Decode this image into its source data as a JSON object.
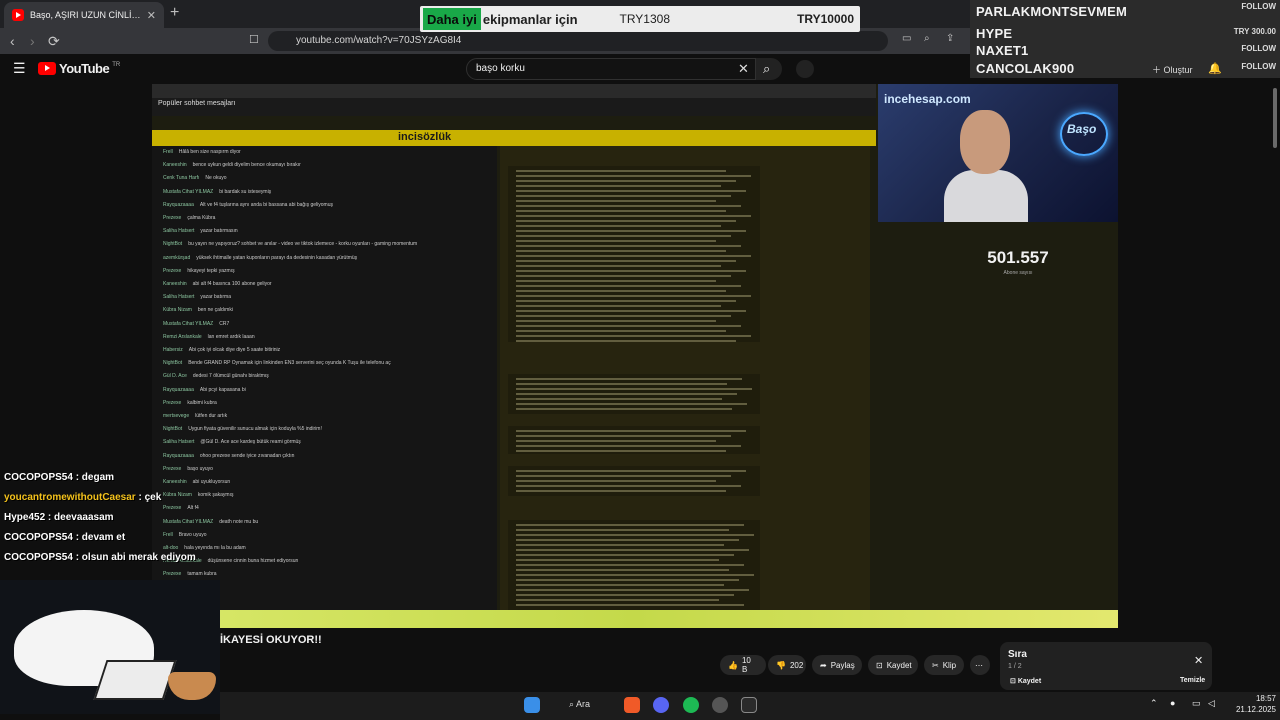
{
  "browser": {
    "tab_title": "Başo, AŞIRI UZUN CİNLİ KORKU...",
    "url": "youtube.com/watch?v=70JSYzAG8I4"
  },
  "ad": {
    "highlight": "Daha iyi",
    "rest": "ekipmanlar için",
    "price1": "TRY1308",
    "price2": "TRY10000"
  },
  "youtube": {
    "logo": "YouTube",
    "region": "TR",
    "search_value": "başo korku",
    "create_label": "Oluştur"
  },
  "donors": [
    {
      "name": "PARLAKMONTSEVMEM",
      "tag": "FOLLOW"
    },
    {
      "name": "HYPE",
      "tag": "TRY 300.00"
    },
    {
      "name": "NAXET1",
      "tag": "FOLLOW"
    },
    {
      "name": "CANCOLAK900",
      "tag": "FOLLOW"
    }
  ],
  "stream": {
    "site_name": "incisözlük",
    "popular_label": "Popüler sohbet mesajları",
    "cam_brand": "incehesap.com",
    "neon": "Başo",
    "counter": "501.557",
    "counter_sub": "Abone sayısı",
    "chat": [
      {
        "n": "Frell",
        "m": "Hâlâ ben size naspırm diyor"
      },
      {
        "n": "Kaneeshin",
        "m": "bence uykun geldi diyelim bence okumayı bırakır"
      },
      {
        "n": "Cenk Tuna Harfı",
        "m": "Ne okuyo"
      },
      {
        "n": "Mustafa Cihat YILMAZ",
        "m": "bi bardak su isteseymiş"
      },
      {
        "n": "Rayquazaaaa",
        "m": "Alt ve f4 tuşlarına aynı anda bi bassana abi bağış geliyomuş"
      },
      {
        "n": "Prezexe",
        "m": "çalma Kübra"
      },
      {
        "n": "Saliha Hatsert",
        "m": "yazar batırmasın"
      },
      {
        "n": "NightBot",
        "m": "bu yayın ne yapıyoruz? sohbet ve anılar - video ve tiktok izlemece - korku oyunları - gaming momentum"
      },
      {
        "n": "azemkürşad",
        "m": "yüksek ihtimalle yatan kuponların parayı da dedesinin kasadan yürütmüş"
      },
      {
        "n": "Prezexe",
        "m": "hikayeyi tepki yazmış"
      },
      {
        "n": "Kaneeshin",
        "m": "abi alt f4 basınca 100 abone geliyor"
      },
      {
        "n": "Saliha Hatsert",
        "m": "yazar batırma"
      },
      {
        "n": "Kübra Nizam",
        "m": "ben ne çaldımki"
      },
      {
        "n": "Mustafa Cihat YILMAZ",
        "m": "CR7"
      },
      {
        "n": "Remzi Arslankale",
        "m": "lan emret ardık laaan"
      },
      {
        "n": "Habersiz",
        "m": "Abi çok iyi olcak diye diye 5 saate bitiriniz"
      },
      {
        "n": "NightBot",
        "m": "Bende GRAND RP Oynamak için linkinden EN3 serverini seç oyunda K Tuşu ile telefonu aç"
      },
      {
        "n": "Gül D. Ace",
        "m": "dedesi 7 ölümcül günahı biraktmış"
      },
      {
        "n": "Rayquazaaaa",
        "m": "Abi pcyi kapasana bi"
      },
      {
        "n": "Prezexe",
        "m": "kalbimi kubra"
      },
      {
        "n": "mertsevege",
        "m": "lütfen dur artık"
      },
      {
        "n": "NightBot",
        "m": "Uygun fiyata güvenilir sunucu almak için koduyla %5 indirim!"
      },
      {
        "n": "Saliha Hatsert",
        "m": "@Gül D. Ace ace kardeş bütük reami görmüş"
      },
      {
        "n": "Rayquazaaaa",
        "m": "ohoo prezexe sende iyice zıvanadan çıktın"
      },
      {
        "n": "Prezexe",
        "m": "başo uyuyo"
      },
      {
        "n": "Kaneeshin",
        "m": "abi uyukluyorsun"
      },
      {
        "n": "Kübra Nizam",
        "m": "komik şakaymış"
      },
      {
        "n": "Prezexe",
        "m": "Alt f4"
      },
      {
        "n": "Mustafa Cihat YILMAZ",
        "m": "death note mu bu"
      },
      {
        "n": "Frell",
        "m": "Bravo uyuyo"
      },
      {
        "n": "alt-doo",
        "m": "hala yeyında mı la bu adam"
      },
      {
        "n": "Remzi Arslankale",
        "m": "düşünsene cinnin buna hizmet ediyorsun"
      },
      {
        "n": "Prezexe",
        "m": "tamam kubra"
      }
    ]
  },
  "overlay_chat": [
    {
      "user": "COCOPOPS54",
      "msg": ": degam",
      "color": "#ffffff"
    },
    {
      "user": "youcantromewithoutCaesar",
      "msg": ": çek",
      "color": "#f4c21c"
    },
    {
      "user": "Hype452",
      "msg": ": deevaaasam",
      "color": "#ffffff"
    },
    {
      "user": "COCOPOPS54",
      "msg": ": devam et",
      "color": "#ffffff"
    },
    {
      "user": "COCOPOPS54",
      "msg": ": olsun abi merak ediyom",
      "color": "#ffffff"
    }
  ],
  "video": {
    "title": "İKAYESİ OKUYOR!!",
    "likes": "10 B",
    "dislikes": "202",
    "share": "Paylaş",
    "save": "Kaydet",
    "clip": "Klip"
  },
  "queue": {
    "title": "Sıra",
    "count": "1 / 2",
    "save": "Kaydet",
    "clear": "Temizle"
  },
  "taskbar": {
    "search": "Ara",
    "time": "18:57",
    "date": "21.12.2025"
  },
  "colors": {
    "yt_red": "#ff0000",
    "site_yellow": "#c8b100",
    "strip_green": "#d9e86a"
  }
}
